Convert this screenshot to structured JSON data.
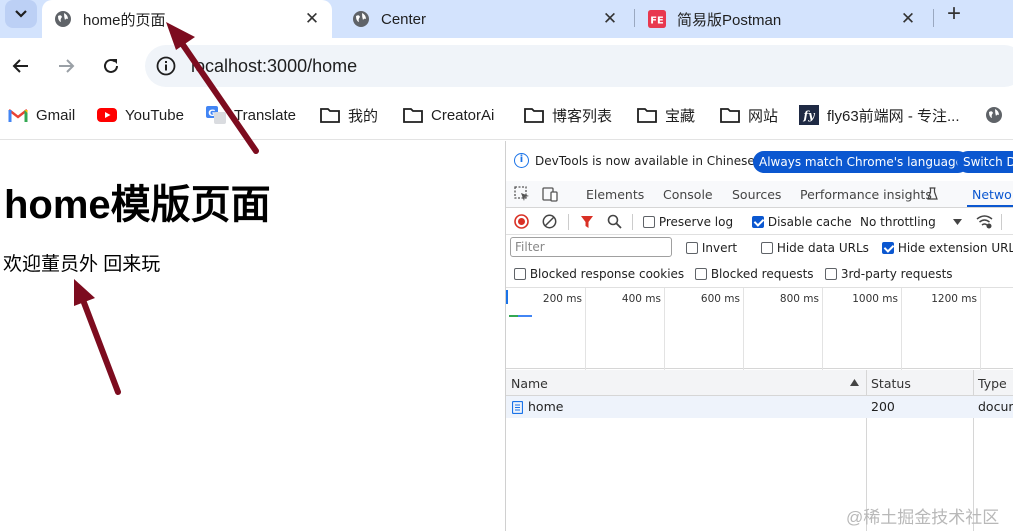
{
  "tabs": [
    {
      "title": "home的页面",
      "active": true,
      "icon": "globe-icon"
    },
    {
      "title": "Center",
      "active": false,
      "icon": "globe-icon"
    },
    {
      "title": "简易版Postman",
      "active": false,
      "icon": "fe-logo-icon"
    }
  ],
  "tab_close_glyph": "✕",
  "new_tab_glyph": "+",
  "address": {
    "url": "localhost:3000/home"
  },
  "bookmarks": [
    {
      "label": "Gmail",
      "icon": "gmail-icon"
    },
    {
      "label": "YouTube",
      "icon": "youtube-icon"
    },
    {
      "label": "Translate",
      "icon": "translate-icon"
    },
    {
      "label": "我的",
      "icon": "folder-icon"
    },
    {
      "label": "CreatorAi",
      "icon": "folder-icon"
    },
    {
      "label": "博客列表",
      "icon": "folder-icon"
    },
    {
      "label": "宝藏",
      "icon": "folder-icon"
    },
    {
      "label": "网站",
      "icon": "folder-icon"
    },
    {
      "label": "fly63前端网 - 专注...",
      "icon": "fly63-icon"
    }
  ],
  "page": {
    "heading": "home模版页面",
    "paragraph": "欢迎董员外 回来玩"
  },
  "devtools": {
    "info_message": "DevTools is now available in Chinese!",
    "info_button_1": "Always match Chrome's language",
    "info_button_2": "Switch Do",
    "tabs": [
      "Elements",
      "Console",
      "Sources",
      "Performance insights",
      "Network"
    ],
    "active_tab": "Network",
    "toolbar": {
      "preserve_log": "Preserve log",
      "preserve_log_checked": false,
      "disable_cache": "Disable cache",
      "disable_cache_checked": true,
      "throttling": "No throttling"
    },
    "filter_placeholder": "Filter",
    "invert": "Invert",
    "hide_data_urls": "Hide data URLs",
    "hide_extension_urls": "Hide extension URLs",
    "hide_extension_urls_checked": true,
    "blocked_response_cookies": "Blocked response cookies",
    "blocked_requests": "Blocked requests",
    "third_party_requests": "3rd-party requests",
    "timeline_ticks": [
      "200 ms",
      "400 ms",
      "600 ms",
      "800 ms",
      "1000 ms",
      "1200 ms"
    ],
    "columns": [
      "Name",
      "Status",
      "Type"
    ],
    "requests": [
      {
        "name": "home",
        "status": "200",
        "type": "docun"
      }
    ]
  },
  "watermark": "@稀土掘金技术社区",
  "colors": {
    "tabstrip": "#d3e3fd",
    "accent": "#0b57d0",
    "annotation_arrow": "#7d0c1f"
  }
}
